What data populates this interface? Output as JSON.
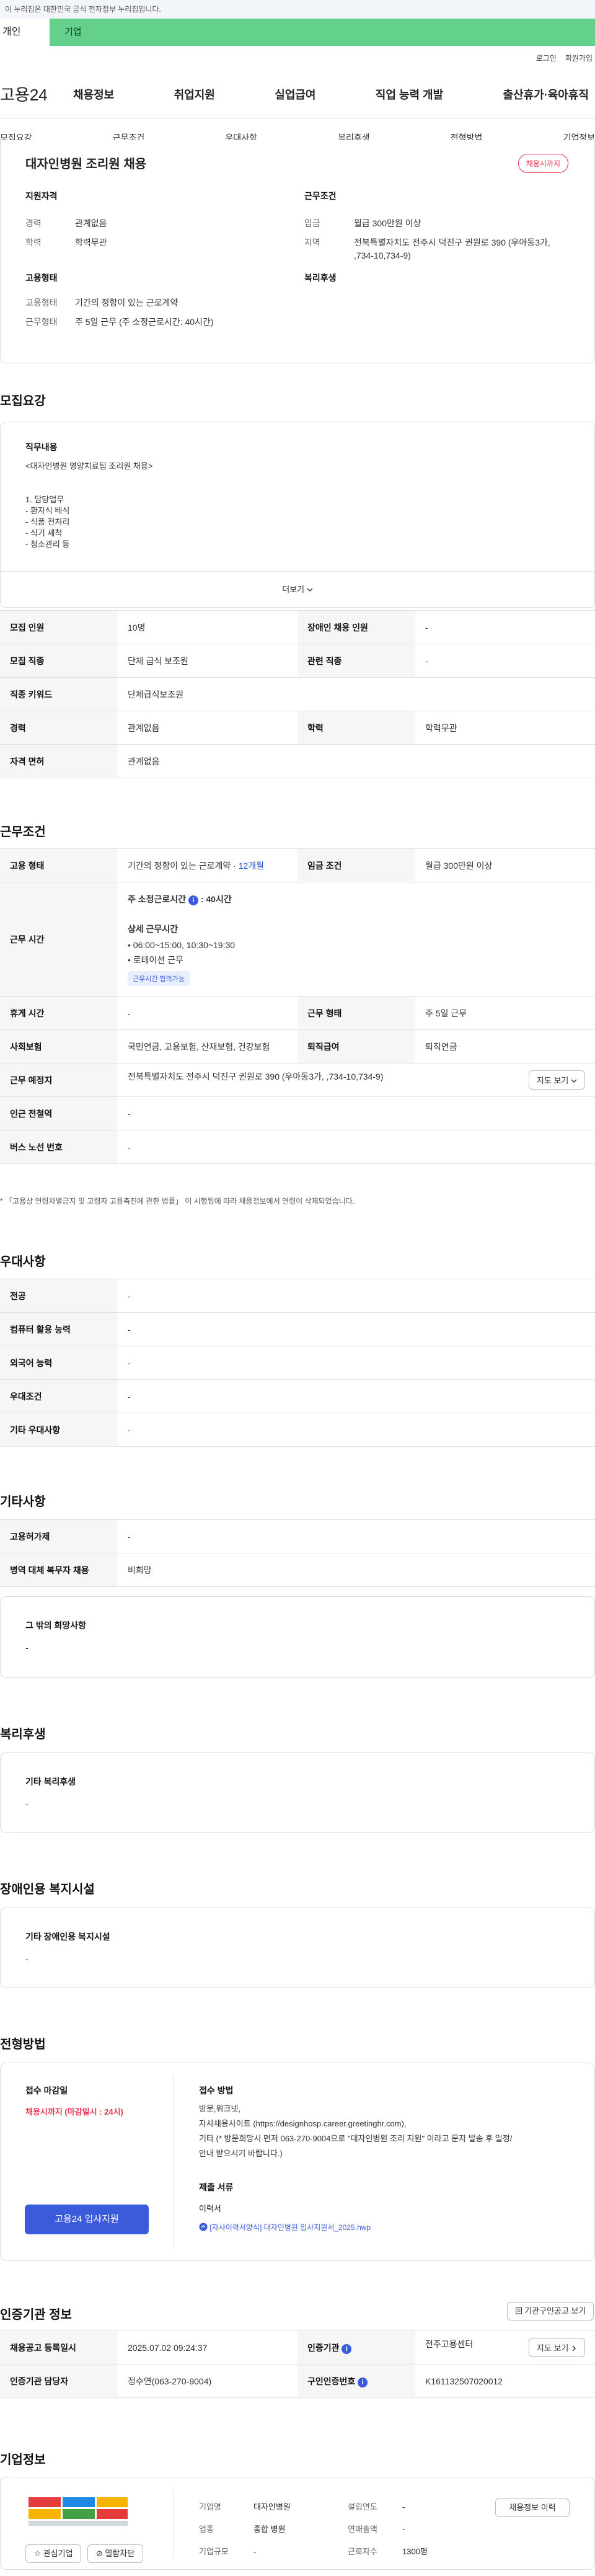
{
  "gov_banner": "이 누리집은 대한민국 공식 전자정부 누리집입니다.",
  "tabs": {
    "personal": "개인",
    "company": "기업"
  },
  "util": {
    "login": "로그인",
    "signup": "회원가입"
  },
  "logo": "고용24",
  "gnb": [
    "채용정보",
    "취업지원",
    "실업급여",
    "직업 능력 개발",
    "출산휴가·육아휴직"
  ],
  "subnav": [
    "모집요강",
    "근무조건",
    "우대사항",
    "복리후생",
    "전형방법",
    "기업정보"
  ],
  "summary": {
    "title": "대자인병원 조리원 채용",
    "badge": "채용시까지",
    "qual_head": "지원자격",
    "qual": [
      {
        "k": "경력",
        "v": "관계없음"
      },
      {
        "k": "학력",
        "v": "학력무관"
      }
    ],
    "cond_head": "근무조건",
    "cond": [
      {
        "k": "임금",
        "v": "월급 300만원 이상"
      },
      {
        "k": "지역",
        "v": "전북특별자치도 전주시 덕진구 권원로 390 (우아동3가, ,734-10,734-9)"
      }
    ],
    "emp_head": "고용형태",
    "emp": [
      {
        "k": "고용형태",
        "v": "기간의 정함이 있는 근로계약"
      },
      {
        "k": "근무형태",
        "v": "주 5일 근무 (주 소정근로시간: 40시간)"
      }
    ],
    "welfare_head": "복리후생"
  },
  "recruit": {
    "title": "모집요강",
    "duty_head": "직무내용",
    "duty_lines": [
      "<대자인병원 영양치료팀 조리원 채용>",
      "",
      "",
      "1. 담당업무",
      "- 환자식 배식",
      "- 식품 전처리",
      "- 식기 세척",
      "- 청소관리 등"
    ],
    "more": "더보기",
    "rows": [
      {
        "k1": "모집 인원",
        "v1": "10명",
        "k2": "장애인 채용 인원",
        "v2": "-"
      },
      {
        "k1": "모집 직종",
        "v1": "단체 급식 보조원",
        "k2": "관련 직종",
        "v2": "-"
      },
      {
        "k1": "직종 키워드",
        "v1": "단체급식보조원"
      },
      {
        "k1": "경력",
        "v1": "관계없음",
        "k2": "학력",
        "v2": "학력무관"
      },
      {
        "k1": "자격 면허",
        "v1": "관계없음"
      }
    ]
  },
  "work": {
    "title": "근무조건",
    "emp_type_k": "고용 형태",
    "emp_type_v": "기간의 정함이 있는 근로계약",
    "emp_period": "12개월",
    "wage_k": "임금 조건",
    "wage_v": "월급 300만원 이상",
    "hours_k": "근무 시간",
    "hours_main": "주 소정근로시간",
    "hours_value": ": 40시간",
    "hours_detail_head": "상세 근무시간",
    "hours_detail": [
      "• 06:00~15:00, 10:30~19:30",
      "• 로테이션 근무"
    ],
    "hours_chip": "근무시간 협의가능",
    "break_k": "휴게 시간",
    "break_v": "-",
    "worktype_k": "근무 형태",
    "worktype_v": "주 5일 근무",
    "insurance_k": "사회보험",
    "insurance_v": "국민연금, 고용보험, 산재보험, 건강보험",
    "retire_k": "퇴직급여",
    "retire_v": "퇴직연금",
    "place_k": "근무 예정지",
    "place_v": "전북특별자치도 전주시 덕진구 권원로 390 (우아동3가, ,734-10,734-9)",
    "map_btn": "지도 보기",
    "subway_k": "인근 전철역",
    "subway_v": "-",
    "bus_k": "버스 노선 번호",
    "bus_v": "-",
    "note": "* 「고용상 연령차별금지 및 고령자 고용촉진에 관한 법률」 이 시행됨에 따라 채용정보에서 연령이 삭제되었습니다."
  },
  "prefer": {
    "title": "우대사항",
    "rows": [
      {
        "k": "전공",
        "v": "-"
      },
      {
        "k": "컴퓨터 활용 능력",
        "v": "-"
      },
      {
        "k": "외국어 능력",
        "v": "-"
      },
      {
        "k": "우대조건",
        "v": "-"
      },
      {
        "k": "기타 우대사항",
        "v": "-"
      }
    ]
  },
  "etc": {
    "title": "기타사항",
    "rows": [
      {
        "k": "고용허가제",
        "v": "-"
      },
      {
        "k": "병역 대체 복무자 채용",
        "v": "비희망"
      }
    ],
    "other_head": "그 밖의 희망사항",
    "other_v": "-"
  },
  "welfare": {
    "title": "복리후생",
    "head": "기타 복리후생",
    "v": "-"
  },
  "disability": {
    "title": "장애인용 복지시설",
    "head": "기타 장애인용 복지시설",
    "v": "-"
  },
  "process": {
    "title": "전형방법",
    "deadline_head": "접수 마감일",
    "deadline": "채용시까지 (마감일시 : 24시)",
    "method_head": "접수 방법",
    "method_lines": [
      "방문,워크넷,",
      "자사채용사이트 (https://designhosp.career.greetinghr.com),",
      "기타 (* 방문희망시 먼저 063-270-9004으로 \"대자인병원 조리 지원\" 이라고 문자 발송 후 일정/",
      "안내 받으시기 바랍니다.)"
    ],
    "docs_head": "제출 서류",
    "docs": "이력서",
    "file": "[자사이력서양식] 대자인병원 입사지원서_2025.hwp",
    "apply": "고용24 입사지원"
  },
  "cert": {
    "title": "인증기관 정보",
    "search_btn": "기관구인공고 보기",
    "reg_k": "채용공고 등록일시",
    "reg_v": "2025.07.02 09:24:37",
    "org_k": "인증기관",
    "org_v": "전주고용센터",
    "map_btn": "지도 보기",
    "mgr_k": "인증기관 담당자",
    "mgr_v": "정수연(063-270-9004)",
    "no_k": "구인인증번호",
    "no_v": "K161132507020012"
  },
  "company": {
    "title": "기업정보",
    "name_k": "기업명",
    "name_v": "대자인병원",
    "found_k": "설립연도",
    "found_v": "-",
    "industry_k": "업종",
    "industry_v": "종합 병원",
    "sales_k": "연매출액",
    "sales_v": "-",
    "scale_k": "기업규모",
    "scale_v": "-",
    "emp_k": "근로자수",
    "emp_v": "1300명",
    "info_btn": "채용정보 이력",
    "fav_btn": "관심기업",
    "block_btn": "열람차단"
  }
}
